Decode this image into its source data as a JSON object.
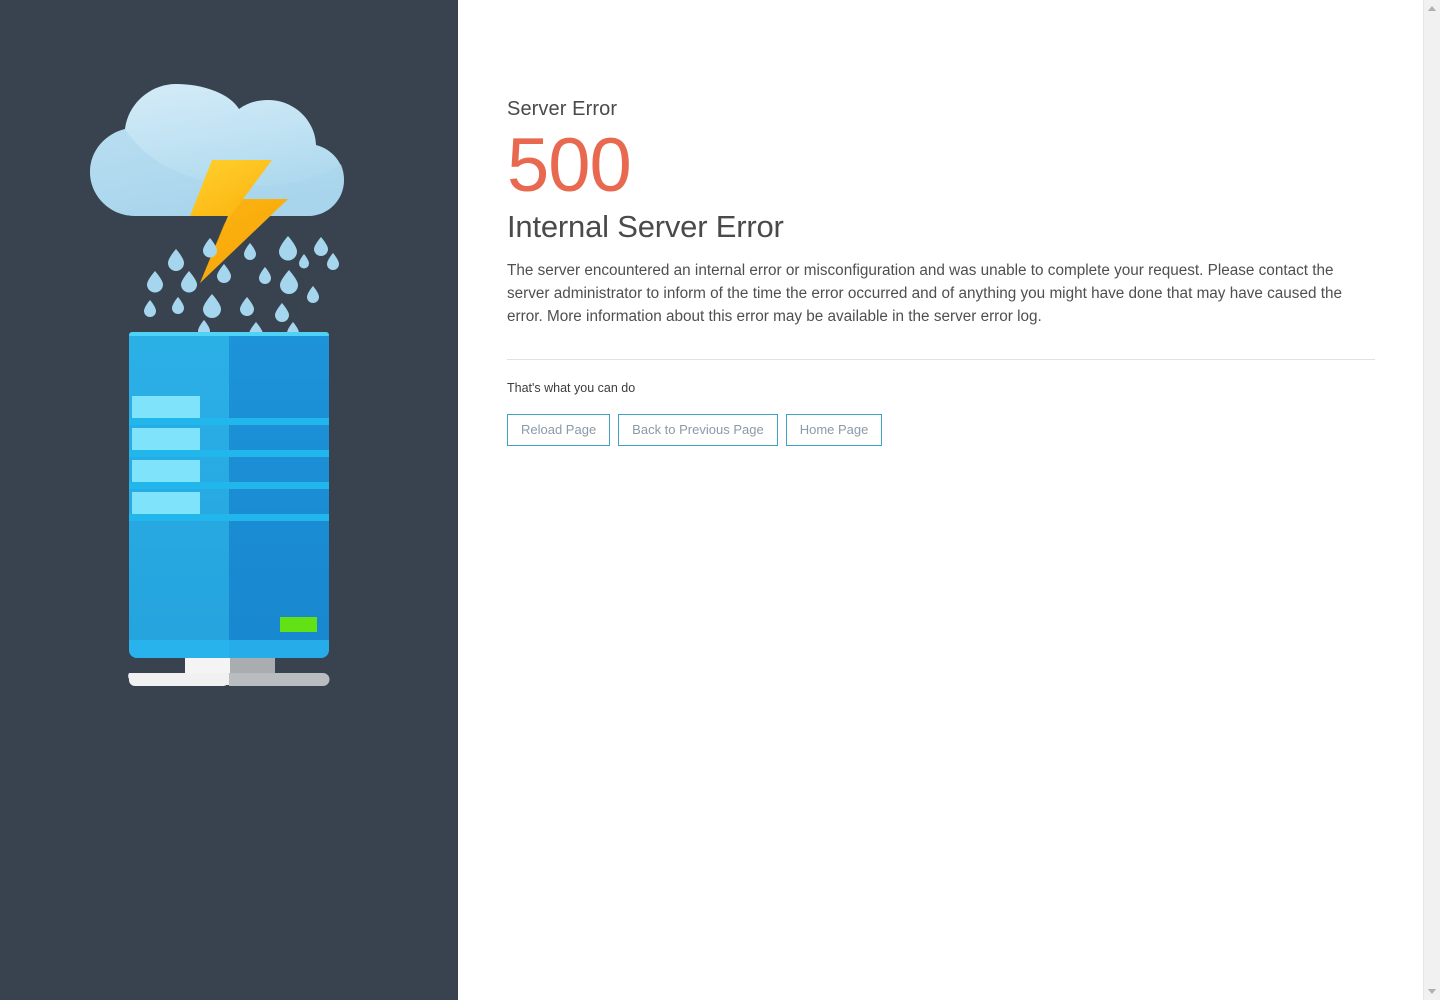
{
  "page": {
    "background_color": "#ffffff",
    "panel_color": "#38434f"
  },
  "illustration": {
    "name": "storm-cloud-over-server-tower",
    "cloud_color": "#bde0f2",
    "cloud_shadow_color": "#a8d3ea",
    "bolt_color": "#fdb813",
    "bolt_highlight_color": "#ffcc29",
    "raindrop_color": "#a6d6ee",
    "server_left_color": "#29abe2",
    "server_right_color": "#1b8fd6",
    "server_top_strip_color": "#4fd2f5",
    "server_slot_color": "#7fe4fb",
    "server_stripe_color": "#22b7ec",
    "server_led_color": "#62e215",
    "stand_light_color": "#f4f4f4",
    "stand_dark_color": "#a9adb0"
  },
  "error": {
    "eyebrow": "Server Error",
    "code": "500",
    "code_color": "#e8694f",
    "title": "Internal Server Error",
    "description": "The server encountered an internal error or misconfiguration and was unable to complete your request. Please contact the server administrator to inform of the time the error occurred and of anything you might have done that may have caused the error. More information about this error may be available in the server error log."
  },
  "actions": {
    "label": "That's what you can do",
    "border_color": "#3fa2c4",
    "text_color": "#8a9aa8",
    "buttons": [
      {
        "label": "Reload Page",
        "name": "reload-page-button"
      },
      {
        "label": "Back to Previous Page",
        "name": "back-to-previous-page-button"
      },
      {
        "label": "Home Page",
        "name": "home-page-button"
      }
    ]
  },
  "scrollbar": {
    "up_arrow": "scroll-up-arrow",
    "down_arrow": "scroll-down-arrow",
    "track_color": "#f1f1f1"
  }
}
